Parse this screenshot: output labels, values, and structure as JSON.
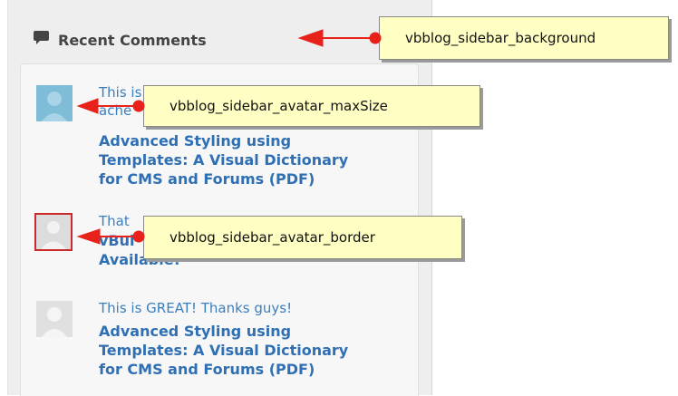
{
  "sidebar": {
    "title": "Recent Comments",
    "comments": [
      {
        "text": "This is",
        "text_cont": "ache",
        "title_lines": [
          "Advanced Styling using",
          "Templates: A Visual Dictionary",
          "for CMS and Forums (PDF)"
        ]
      },
      {
        "text": "That",
        "text_cont": "vBul",
        "title_lines": [
          "Available!"
        ]
      },
      {
        "text": "This is GREAT! Thanks guys!",
        "title_lines": [
          "Advanced Styling using",
          "Templates: A Visual Dictionary",
          "for CMS and Forums (PDF)"
        ]
      }
    ]
  },
  "callouts": {
    "background": "vbblog_sidebar_background",
    "avatar_max_size": "vbblog_sidebar_avatar_maxSize",
    "avatar_border": "vbblog_sidebar_avatar_border"
  },
  "colors": {
    "accent_red": "#e8221b",
    "link_blue": "#2f6fb3",
    "callout_yellow": "#ffffc4",
    "avatar_border": "#cc2a2a"
  }
}
